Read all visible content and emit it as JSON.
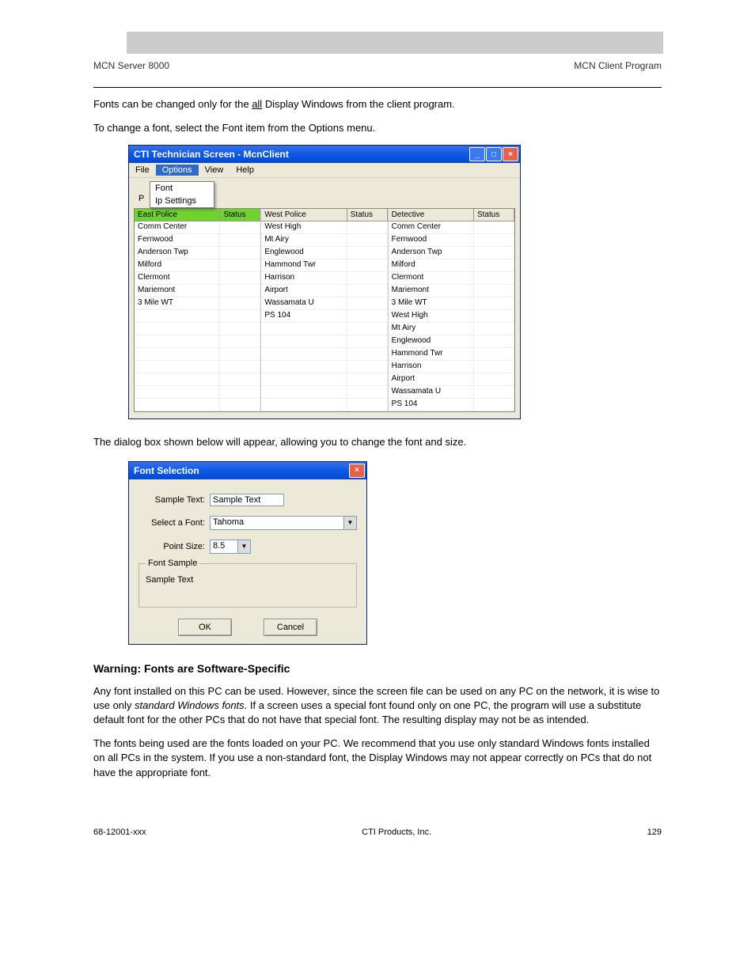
{
  "page_header": {
    "left": "MCN Server 8000",
    "right": "MCN Client Program"
  },
  "intro_line1_prefix": "Fonts can be changed only for the ",
  "intro_line1_underlined": "all",
  "intro_line1_suffix": " Display Windows from the client program.",
  "intro_line2": "To change a font, select the Font item from the Options menu.",
  "win1": {
    "title": "CTI Technician Screen - McnClient",
    "menus": [
      "File",
      "Options",
      "View",
      "Help"
    ],
    "dropdown": [
      "Font",
      "Ip Settings"
    ],
    "side_p": "P",
    "columns": [
      {
        "header": "East Police",
        "status": "Status",
        "rows": [
          "Comm Center",
          "Fernwood",
          "Anderson Twp",
          "Milford",
          "Clermont",
          "Mariemont",
          "3 Mile WT",
          "",
          "",
          "",
          "",
          "",
          "",
          "",
          ""
        ]
      },
      {
        "header": "West Police",
        "status": "Status",
        "rows": [
          "West High",
          "Mt Airy",
          "Englewood",
          "Hammond Twr",
          "Harrison",
          "Airport",
          "Wassamata U",
          "PS 104",
          "",
          "",
          "",
          "",
          "",
          "",
          ""
        ]
      },
      {
        "header": "Detective",
        "status": "Status",
        "rows": [
          "Comm Center",
          "Fernwood",
          "Anderson Twp",
          "Milford",
          "Clermont",
          "Mariemont",
          "3 Mile WT",
          "West High",
          "Mt Airy",
          "Englewood",
          "Hammond Twr",
          "Harrison",
          "Airport",
          "Wassamata U",
          "PS 104"
        ]
      }
    ]
  },
  "mid_text": "The dialog box shown below will appear, allowing you to change the font and size.",
  "win2": {
    "title": "Font Selection",
    "labels": {
      "sample_text": "Sample Text:",
      "select_font": "Select a Font:",
      "point_size": "Point Size:",
      "font_sample": "Font Sample"
    },
    "values": {
      "sample_text": "Sample Text",
      "font": "Tahoma",
      "size": "8.5",
      "sample": "Sample Text"
    },
    "buttons": {
      "ok": "OK",
      "cancel": "Cancel"
    }
  },
  "warning": {
    "heading": "Warning: Fonts are Software-Specific",
    "p1a": "Any font installed on this PC can be used. However, since the screen file can be used on any PC on the network, it is wise to use only ",
    "p1b": "standard Windows fonts",
    "p1c": ". If a screen uses a special font found only on one PC, the program will use a substitute default font for the other PCs that do not have that special font. The resulting display may not be as intended.",
    "p2": "The fonts being used are the fonts loaded on your PC. We recommend that you use only standard Windows fonts installed on all PCs in the system. If you use a non-standard font, the Display Windows may not appear correctly on PCs that do not have the appropriate font."
  },
  "footer": {
    "left": "68-12001-xxx",
    "center": "CTI Products, Inc.",
    "right": "129"
  }
}
